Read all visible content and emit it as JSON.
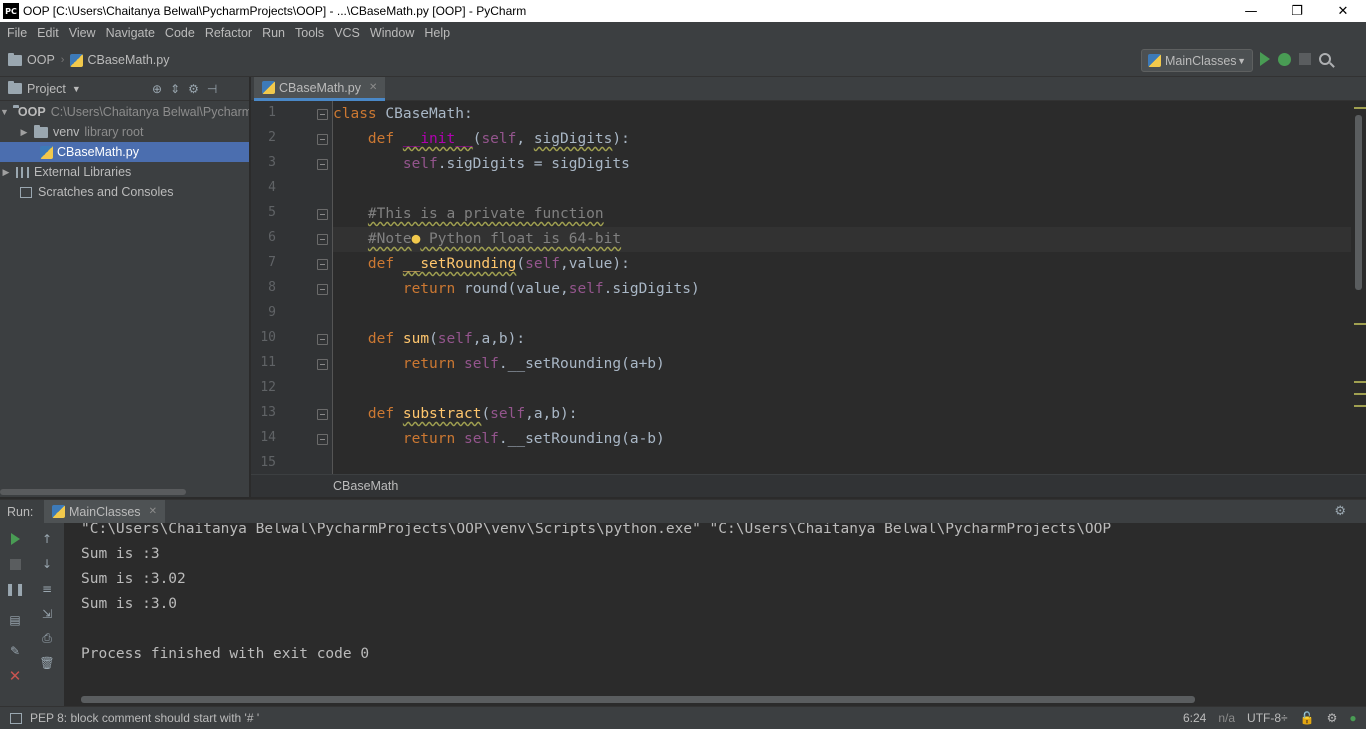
{
  "window": {
    "title": "OOP [C:\\Users\\Chaitanya Belwal\\PycharmProjects\\OOP] - ...\\CBaseMath.py [OOP] - PyCharm",
    "logo": "PC",
    "minimize": "—",
    "restore": "❐",
    "close": "✕"
  },
  "menu": [
    "File",
    "Edit",
    "View",
    "Navigate",
    "Code",
    "Refactor",
    "Run",
    "Tools",
    "VCS",
    "Window",
    "Help"
  ],
  "navbar": {
    "project": "OOP",
    "file": "CBaseMath.py",
    "run_config": "MainClasses"
  },
  "project_panel": {
    "title": "Project",
    "root_name": "OOP",
    "root_path": "C:\\Users\\Chaitanya Belwal\\PycharmProjects\\OOP",
    "venv_name": "venv",
    "venv_hint": "library root",
    "file": "CBaseMath.py",
    "external_libraries": "External Libraries",
    "scratches": "Scratches and Consoles"
  },
  "editor": {
    "tab": "CBaseMath.py",
    "line_numbers": [
      "1",
      "2",
      "3",
      "4",
      "5",
      "6",
      "7",
      "8",
      "9",
      "10",
      "11",
      "12",
      "13",
      "14",
      "15"
    ],
    "code": {
      "l1_kw": "class",
      "l1_rest": " CBaseMath:",
      "l2_kw": "def",
      "l2_fn": "__init__",
      "l2_p1": "(",
      "l2_self": "self",
      "l2_p2": ", ",
      "l2_arg": "sigDigits",
      "l2_p3": "):",
      "l3_self": "self",
      "l3_rest": ".sigDigits = sigDigits",
      "l5_cm": "#This is a private function",
      "l6_cm1": "#Note",
      "l6_cm2": " Python float is 64-bit",
      "l7_kw": "def",
      "l7_fn": "__setRounding",
      "l7_p1": "(",
      "l7_self": "self",
      "l7_p2": ",value):",
      "l8_kw": "return",
      "l8_p1": " round(value,",
      "l8_self": "self",
      "l8_p2": ".sigDigits)",
      "l10_kw": "def",
      "l10_fn": "sum",
      "l10_p1": "(",
      "l10_self": "self",
      "l10_p2": ",a,b):",
      "l11_kw": "return",
      "l11_self": "self",
      "l11_p2": ".__setRounding(a+b)",
      "l13_kw": "def",
      "l13_fn": "substract",
      "l13_p1": "(",
      "l13_self": "self",
      "l13_p2": ",a,b):",
      "l14_kw": "return",
      "l14_self": "self",
      "l14_p2": ".__setRounding(a-b)"
    },
    "breadcrumb": "CBaseMath"
  },
  "run_panel": {
    "label": "Run:",
    "tab": "MainClasses",
    "output": [
      "\"C:\\Users\\Chaitanya Belwal\\PycharmProjects\\OOP\\venv\\Scripts\\python.exe\" \"C:\\Users\\Chaitanya Belwal\\PycharmProjects\\OOP",
      "Sum is :3",
      "Sum is :3.02",
      "Sum is :3.0",
      "",
      "Process finished with exit code 0"
    ]
  },
  "statusbar": {
    "message": "PEP 8: block comment should start with '# '",
    "position": "6:24",
    "line_sep": "n/a",
    "encoding": "UTF-8÷"
  },
  "colors": {
    "keyword": "#cc7832",
    "self": "#94558d",
    "function": "#ffc66d",
    "comment": "#808080",
    "selection": "#4b6eaf",
    "run_green": "#499c54"
  }
}
